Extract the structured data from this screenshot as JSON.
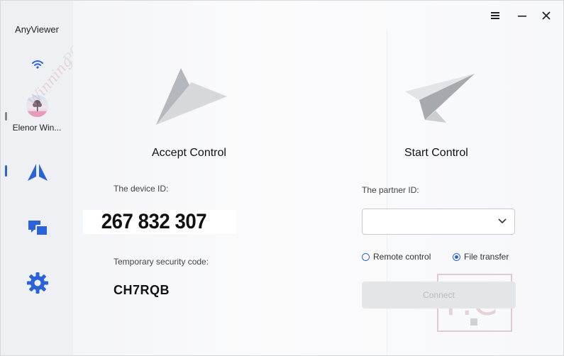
{
  "app": {
    "title": "AnyViewer"
  },
  "sidebar": {
    "user_name": "Elenor Win...",
    "items": [
      {
        "name": "remote-control",
        "icon": "anyviewer-logo-icon",
        "active": true
      },
      {
        "name": "devices",
        "icon": "devices-icon",
        "active": false
      },
      {
        "name": "settings",
        "icon": "gear-icon",
        "active": false
      }
    ]
  },
  "window_controls": {
    "menu_icon": "hamburger-icon",
    "minimize_icon": "minimize-icon",
    "close_icon": "close-icon"
  },
  "accept": {
    "title": "Accept Control",
    "device_id_label": "The device ID:",
    "device_id": "267 832 307",
    "code_label": "Temporary security code:",
    "code": "CH7RQB"
  },
  "start": {
    "title": "Start Control",
    "partner_label": "The partner ID:",
    "partner_value": "",
    "options": [
      {
        "label": "Remote control",
        "selected": false
      },
      {
        "label": "File transfer",
        "selected": true
      }
    ],
    "connect_label": "Connect"
  },
  "colors": {
    "accent": "#2a62d9",
    "sidebar_bg": "#eef0f4"
  }
}
